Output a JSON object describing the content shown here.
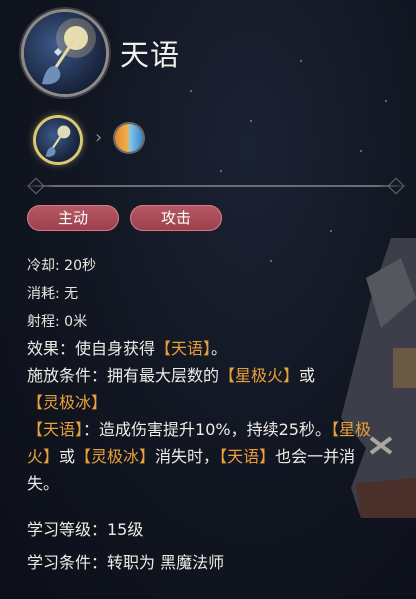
{
  "skill": {
    "name": "天语",
    "icon": "starlight-staff-icon",
    "chain_next_icon": "fire-ice-orb-icon"
  },
  "tags": [
    "主动",
    "攻击"
  ],
  "stats": {
    "cooldown": "冷却: 20秒",
    "cost": "消耗: 无",
    "range": "射程: 0米"
  },
  "effect": {
    "prefix": "效果：使自身获得",
    "buff": "【天语】",
    "suffix": "。"
  },
  "condition": {
    "prefix": "施放条件：拥有最大层数的",
    "fire": "【星极火】",
    "or": "或",
    "ice": "【灵极冰】"
  },
  "buff_desc": {
    "buff": "【天语】",
    "text1": "：造成伤害提升10%，持续25秒。",
    "fire": "【星极火】",
    "or": "或",
    "ice": "【灵极冰】",
    "text2": "消失时，",
    "buff2": "【天语】",
    "text3": "也会一并消失。"
  },
  "learn_level": "学习等级：15级",
  "learn_condition": "学习条件：转职为 黑魔法师",
  "colors": {
    "highlight": "#e9a03a",
    "tag_bg": "#9a3f4b",
    "glow": "#d9c776"
  }
}
